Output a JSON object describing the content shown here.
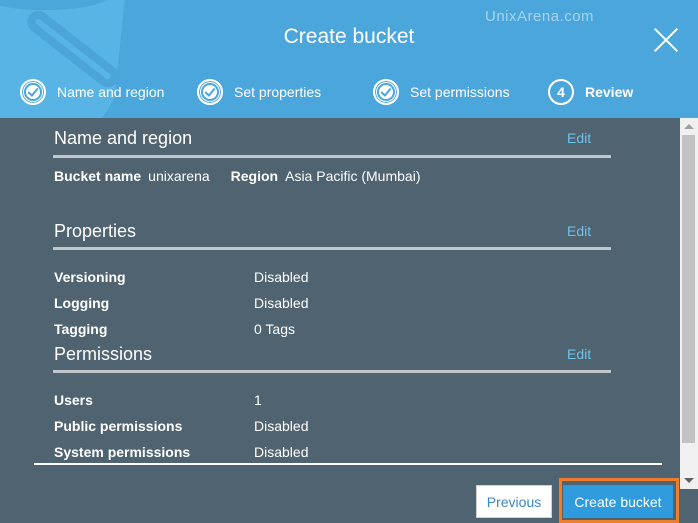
{
  "watermark": "UnixArena.com",
  "dialog": {
    "title": "Create bucket",
    "close_icon": "close-x-icon"
  },
  "steps": [
    {
      "label": "Name and region",
      "state": "done",
      "icon": "check-circle-icon"
    },
    {
      "label": "Set properties",
      "state": "done",
      "icon": "check-circle-icon"
    },
    {
      "label": "Set permissions",
      "state": "done",
      "icon": "check-circle-icon"
    },
    {
      "label": "Review",
      "state": "active",
      "number": "4"
    }
  ],
  "sections": {
    "name_region": {
      "title": "Name and region",
      "edit_label": "Edit",
      "bucket_name_label": "Bucket name",
      "bucket_name_value": "unixarena",
      "region_label": "Region",
      "region_value": "Asia Pacific (Mumbai)"
    },
    "properties": {
      "title": "Properties",
      "edit_label": "Edit",
      "rows": [
        {
          "label": "Versioning",
          "value": "Disabled"
        },
        {
          "label": "Logging",
          "value": "Disabled"
        },
        {
          "label": "Tagging",
          "value": "0 Tags"
        }
      ]
    },
    "permissions": {
      "title": "Permissions",
      "edit_label": "Edit",
      "rows": [
        {
          "label": "Users",
          "value": "1"
        },
        {
          "label": "Public permissions",
          "value": "Disabled"
        },
        {
          "label": "System permissions",
          "value": "Disabled"
        }
      ]
    }
  },
  "footer": {
    "previous_label": "Previous",
    "create_label": "Create bucket"
  },
  "colors": {
    "header_bg": "#4ba6dc",
    "body_bg": "#4f6370",
    "edit_link": "#6cc4ea",
    "primary_button": "#2f9bdd",
    "highlight_outline": "#f07d2a"
  }
}
